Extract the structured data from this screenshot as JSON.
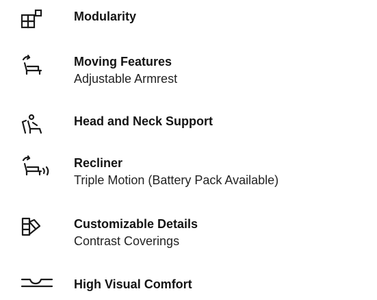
{
  "features": [
    {
      "icon": "modularity-icon",
      "title": "Modularity",
      "subtitle": ""
    },
    {
      "icon": "moving-armrest-chair-icon",
      "title": "Moving Features",
      "subtitle": "Adjustable Armrest"
    },
    {
      "icon": "head-neck-support-icon",
      "title": "Head and Neck Support",
      "subtitle": ""
    },
    {
      "icon": "recliner-chair-icon",
      "title": "Recliner",
      "subtitle": "Triple Motion (Battery Pack Available)"
    },
    {
      "icon": "customizable-details-icon",
      "title": "Customizable Details",
      "subtitle": "Contrast Coverings"
    },
    {
      "icon": "visual-comfort-icon",
      "title": "High Visual Comfort",
      "subtitle": ""
    }
  ],
  "colors": {
    "text": "#141414",
    "icon": "#1a1a1a",
    "background": "#ffffff"
  }
}
